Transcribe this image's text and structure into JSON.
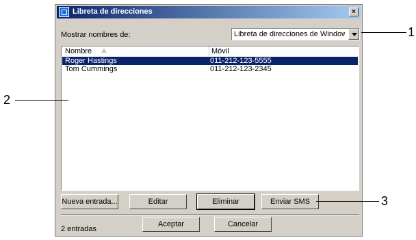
{
  "window": {
    "title": "Libreta de direcciones",
    "close_label": "×"
  },
  "filter": {
    "label": "Mostrar nombres de:",
    "selected": "Libreta de direcciones de Windows"
  },
  "list": {
    "columns": [
      "Nombre",
      "Móvil"
    ],
    "rows": [
      {
        "name": "Roger Hastings",
        "mobile": "011-212-123-5555",
        "selected": true
      },
      {
        "name": "Tom Cummings",
        "mobile": "011-212-123-2345",
        "selected": false
      }
    ]
  },
  "actions": {
    "new": "Nueva entrada...",
    "edit": "Editar",
    "delete": "Eliminar",
    "send_sms": "Enviar SMS"
  },
  "footer": {
    "count": "2 entradas",
    "ok": "Aceptar",
    "cancel": "Cancelar"
  },
  "callouts": [
    "1",
    "2",
    "3"
  ]
}
